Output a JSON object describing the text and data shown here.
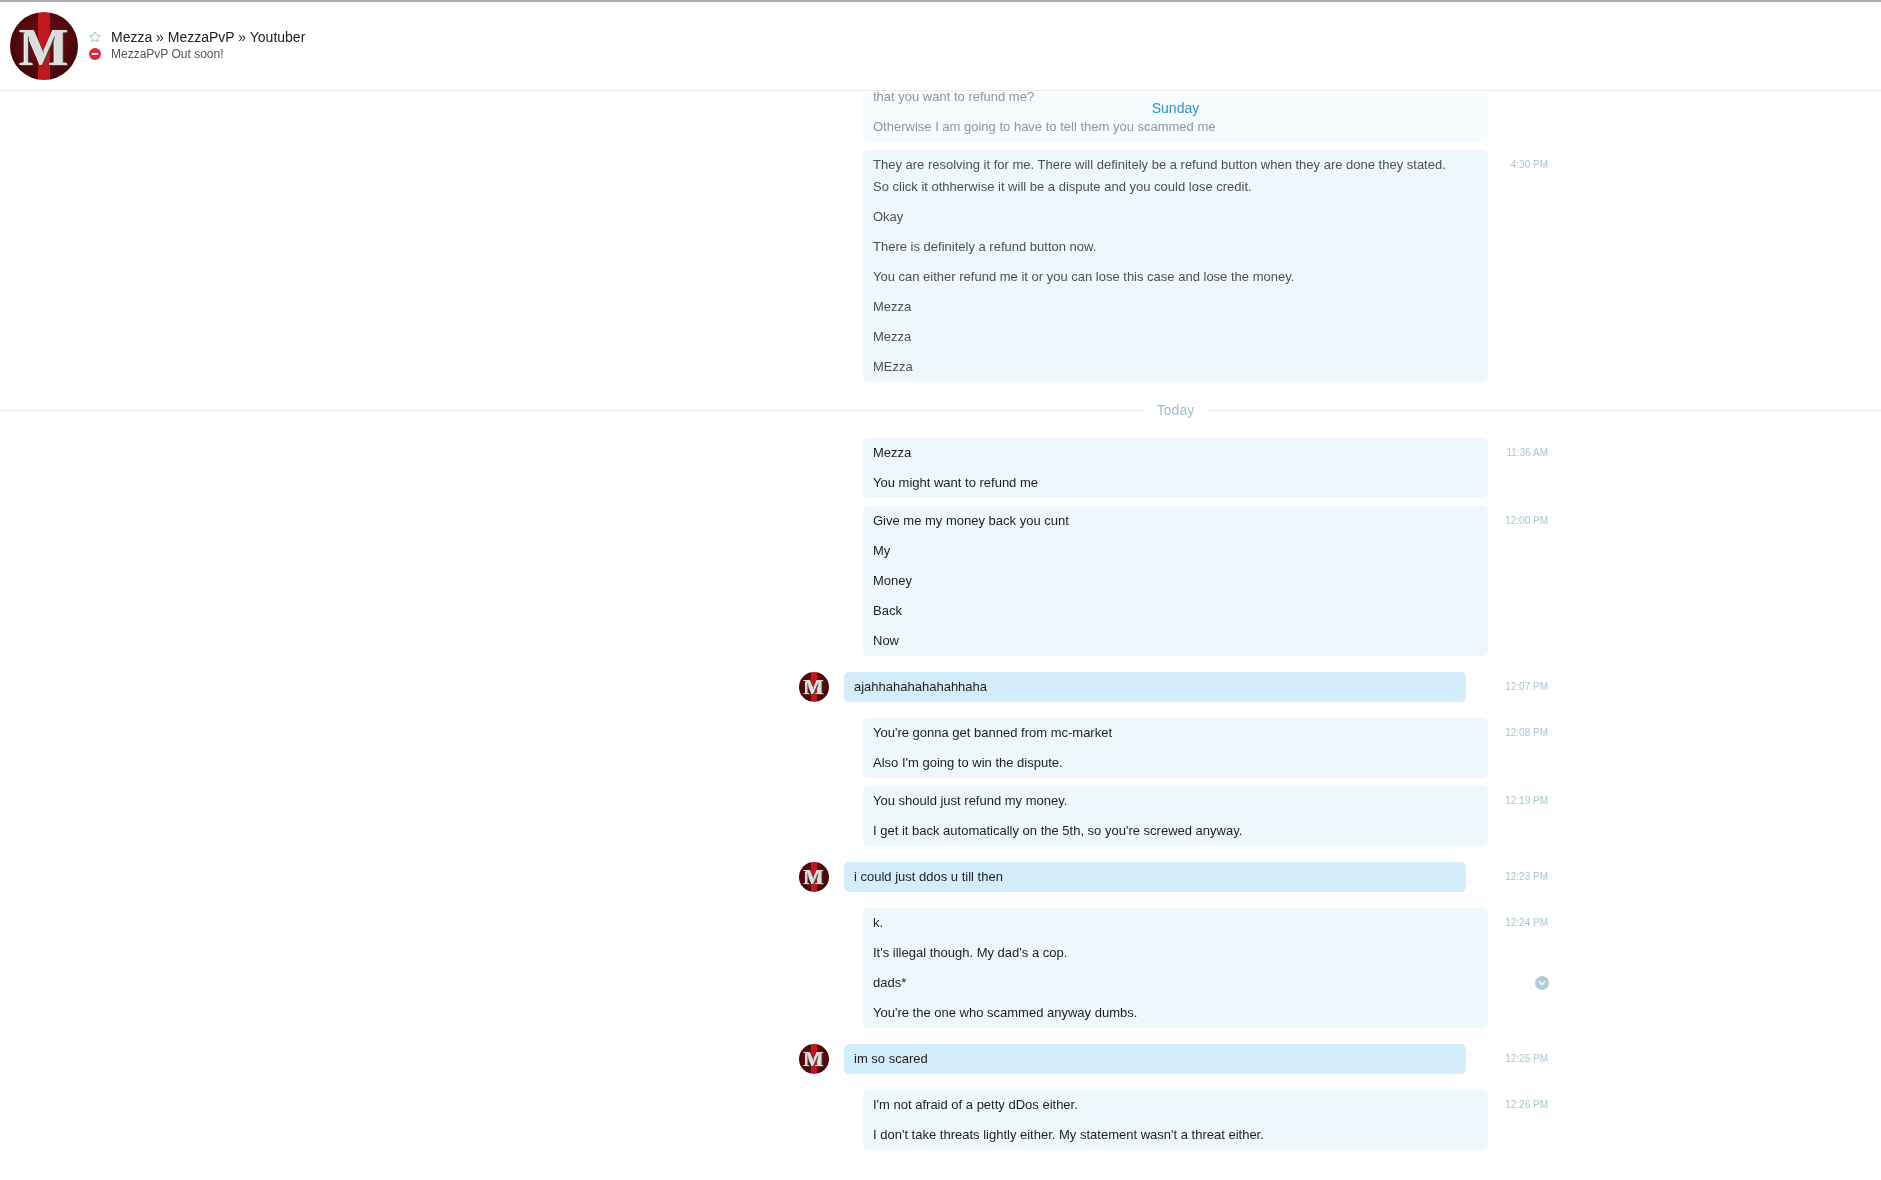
{
  "header": {
    "avatar_letter": "M",
    "favorite": false,
    "title": "Mezza » MezzaPvP » Youtuber",
    "busy": true,
    "status": "MezzaPvP Out soon!"
  },
  "days": [
    {
      "kind": "sticky",
      "label": "Sunday",
      "dimmed": true,
      "messages": [
        {
          "kind": "own",
          "faded": true,
          "lines": [
            {
              "text": "that you want to refund me?",
              "hovered": false
            },
            {
              "text": "Otherwise I am going to have to tell them you scammed me",
              "hovered": false
            }
          ]
        },
        {
          "kind": "own",
          "faded": false,
          "time": "4:30 PM",
          "lines": [
            {
              "text": "They are resolving it for me. There will definitely be a refund button when they are done they stated.\nSo click it othherwise it will be a dispute and you could lose credit.",
              "hovered": false
            },
            {
              "text": "Okay",
              "hovered": false
            },
            {
              "text": "There is definitely a refund button now.",
              "hovered": false
            },
            {
              "text": "You can either refund me it or you can lose this case and lose the money.",
              "hovered": false
            },
            {
              "text": "Mezza",
              "hovered": false
            },
            {
              "text": "Mezza",
              "hovered": false
            },
            {
              "text": "MEzza",
              "hovered": false
            }
          ]
        }
      ]
    },
    {
      "kind": "divider",
      "label": "Today",
      "dimmed": false,
      "messages": [
        {
          "kind": "own",
          "faded": false,
          "time": "11:36 AM",
          "lines": [
            {
              "text": "Mezza",
              "hovered": false
            },
            {
              "text": "You might want to refund me",
              "hovered": false
            }
          ]
        },
        {
          "kind": "own",
          "faded": false,
          "time": "12:00 PM",
          "lines": [
            {
              "text": "Give me my money back you cunt",
              "hovered": false
            },
            {
              "text": "My",
              "hovered": false
            },
            {
              "text": "Money",
              "hovered": false
            },
            {
              "text": "Back",
              "hovered": false
            },
            {
              "text": "Now",
              "hovered": false
            }
          ]
        },
        {
          "kind": "contact",
          "faded": false,
          "avatar_letter": "M",
          "time": "12:07 PM",
          "lines": [
            {
              "text": "ajahhahahahahahhaha",
              "hovered": false
            }
          ]
        },
        {
          "kind": "own",
          "faded": false,
          "time": "12:08 PM",
          "lines": [
            {
              "text": "You're gonna get banned from mc-market",
              "hovered": false
            },
            {
              "text": "Also I'm going to win the dispute.",
              "hovered": false
            }
          ]
        },
        {
          "kind": "own",
          "faded": false,
          "time": "12:19 PM",
          "lines": [
            {
              "text": "You should just refund my money.",
              "hovered": false
            },
            {
              "text": "I get it back automatically on the 5th, so you're screwed anyway.",
              "hovered": false
            }
          ]
        },
        {
          "kind": "contact",
          "faded": false,
          "avatar_letter": "M",
          "time": "12:23 PM",
          "lines": [
            {
              "text": "i could just ddos u till then",
              "hovered": false
            }
          ]
        },
        {
          "kind": "own",
          "faded": false,
          "time": "12:24 PM",
          "lines": [
            {
              "text": "k.",
              "hovered": false
            },
            {
              "text": "It's illegal though. My dad's a cop.",
              "hovered": false
            },
            {
              "text": "dads*",
              "hovered": true
            },
            {
              "text": "You're the one who scammed anyway dumbs.",
              "hovered": false
            }
          ]
        },
        {
          "kind": "contact",
          "faded": false,
          "avatar_letter": "M",
          "time": "12:25 PM",
          "lines": [
            {
              "text": "im so scared",
              "hovered": false
            }
          ]
        },
        {
          "kind": "own",
          "faded": false,
          "time": "12:26 PM",
          "lines": [
            {
              "text": "I'm not afraid of a petty dDos either.",
              "hovered": false
            },
            {
              "text": "I don't take threats lightly either. My statement wasn't a threat either.",
              "hovered": false
            }
          ]
        }
      ]
    }
  ]
}
